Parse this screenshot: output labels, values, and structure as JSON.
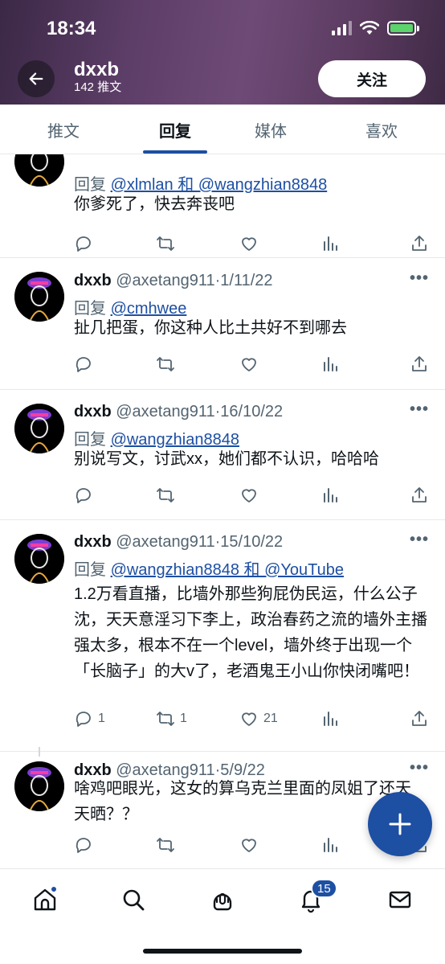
{
  "status_bar": {
    "time": "18:34"
  },
  "profile": {
    "name": "dxxb",
    "posts_count": "142 推文",
    "follow_label": "关注"
  },
  "tabs": [
    {
      "label": "推文"
    },
    {
      "label": "回复"
    },
    {
      "label": "媒体"
    },
    {
      "label": "喜欢"
    }
  ],
  "tweets": [
    {
      "reply_prefix": "回复",
      "reply_to": "@xlmlan 和 @wangzhian8848",
      "text": "你爹死了，快去奔丧吧",
      "replies": "",
      "retweets": "",
      "likes": ""
    },
    {
      "name": "dxxb",
      "handle": "@axetang911",
      "date": "1/11/22",
      "reply_prefix": "回复",
      "reply_to": "@cmhwee",
      "text": "扯几把蛋，你这种人比土共好不到哪去",
      "replies": "",
      "retweets": "",
      "likes": ""
    },
    {
      "name": "dxxb",
      "handle": "@axetang911",
      "date": "16/10/22",
      "reply_prefix": "回复",
      "reply_to": "@wangzhian8848",
      "text": "别说写文，讨武xx，她们都不认识，哈哈哈",
      "replies": "",
      "retweets": "",
      "likes": ""
    },
    {
      "name": "dxxb",
      "handle": "@axetang911",
      "date": "15/10/22",
      "reply_prefix": "回复",
      "reply_to": "@wangzhian8848 和 @YouTube",
      "text": "1.2万看直播，比墙外那些狗屁伪民运，什么公子沈，天天意淫习下李上，政治春药之流的墙外主播强太多，根本不在一个level，墙外终于出现一个「长脑子」的大v了，老酒鬼王小山你快闭嘴吧！",
      "replies": "1",
      "retweets": "1",
      "likes": "21"
    },
    {
      "name": "dxxb",
      "handle": "@axetang911",
      "date": "5/9/22",
      "text": "啥鸡吧眼光，这女的算乌克兰里面的凤姐了还天天晒？？",
      "replies": "",
      "retweets": "",
      "likes": ""
    }
  ],
  "nav": {
    "notifications_count": "15"
  },
  "icons": {
    "back": "arrow-left-icon",
    "reply": "reply-icon",
    "retweet": "retweet-icon",
    "like": "heart-icon",
    "views": "views-icon",
    "share": "share-icon",
    "compose": "plus-icon",
    "home": "home-icon",
    "search": "search-icon",
    "spaces": "spaces-icon",
    "notifications": "bell-icon",
    "messages": "mail-icon"
  },
  "colors": {
    "accent": "#1d4fa3",
    "text": "#0f1419",
    "muted": "#536471"
  }
}
